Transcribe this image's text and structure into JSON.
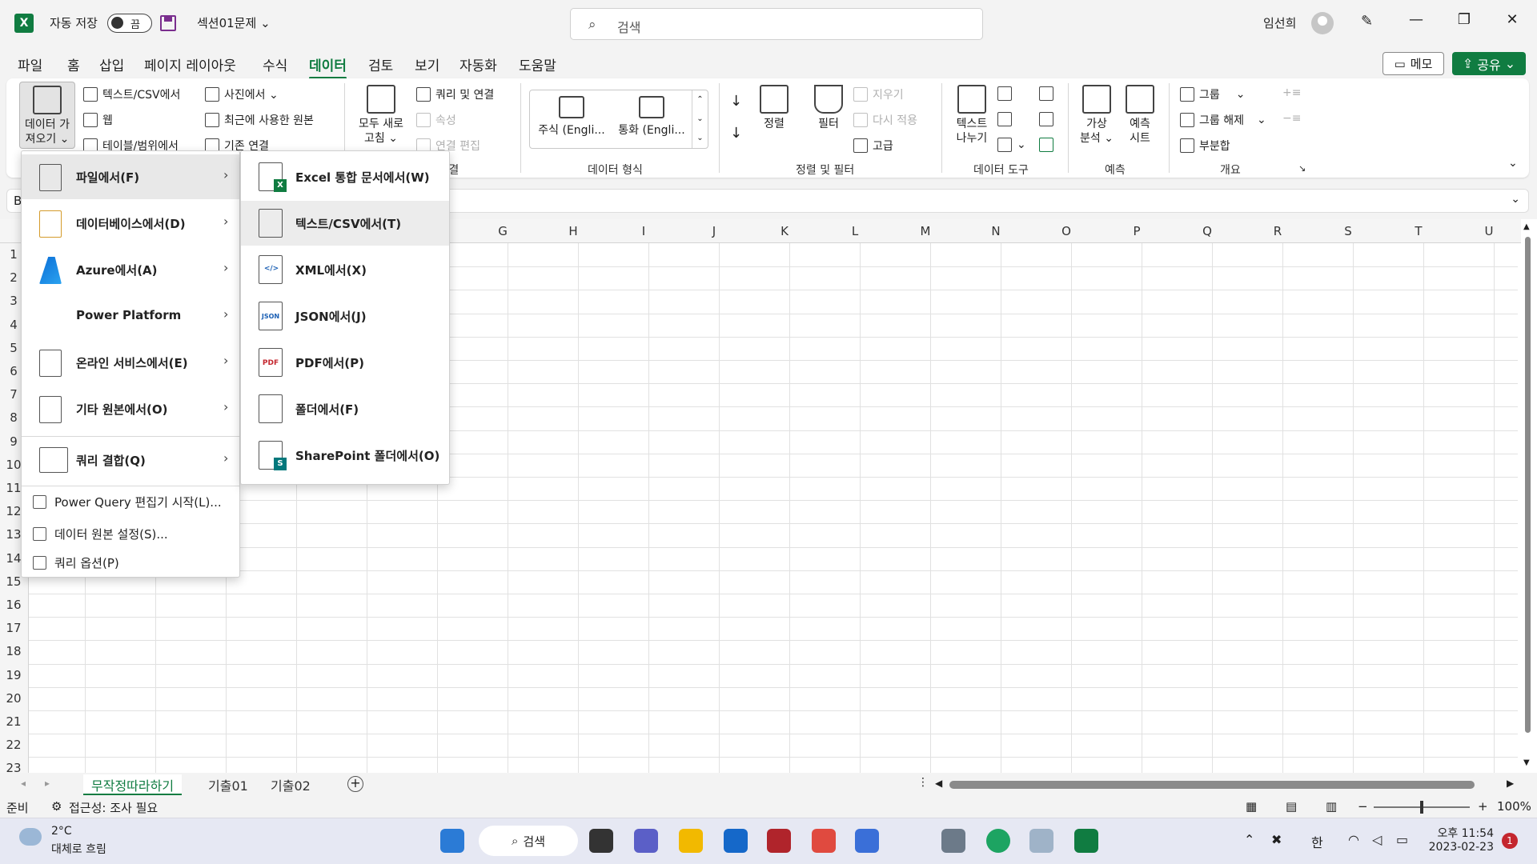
{
  "titlebar": {
    "app_icon": "X",
    "autosave_label": "자동 저장",
    "autosave_state": "끔",
    "document_title": "섹션01문제",
    "search_placeholder": "검색",
    "user_name": "임선희",
    "minimize": "—",
    "restore": "❐",
    "close": "✕"
  },
  "menu_tabs": [
    "파일",
    "홈",
    "삽입",
    "페이지 레이아웃",
    "수식",
    "데이터",
    "검토",
    "보기",
    "자동화",
    "도움말"
  ],
  "active_tab": "데이터",
  "memo_label": "메모",
  "share_label": "공유",
  "ribbon": {
    "get_data": "데이터 가\n져오기 ⌄",
    "text_csv": "텍스트/CSV에서",
    "web": "웹",
    "table_range": "테이블/범위에서",
    "from_picture": "사진에서 ⌄",
    "recent_sources": "최근에 사용한 원본",
    "existing_connections": "기존 연결",
    "refresh_all": "모두 새로\n고침 ⌄",
    "queries_connections": "쿼리 및 연결",
    "properties": "속성",
    "edit_links": "연결 편집",
    "group_queries": "쿼리 및 연결",
    "stocks": "주식 (Engli...",
    "currency": "통화 (Engli...",
    "group_datatypes": "데이터 형식",
    "sort": "정렬",
    "filter": "필터",
    "clear": "지우기",
    "reapply": "다시 적용",
    "advanced": "고급",
    "group_sortfilter": "정렬 및 필터",
    "text_to_columns": "텍스트\n나누기",
    "group_datatools": "데이터 도구",
    "whatif": "가상\n분석 ⌄",
    "forecast_sheet": "예측\n시트",
    "group_forecast": "예측",
    "group": "그룹",
    "ungroup": "그룹 해제",
    "subtotal": "부분합",
    "group_outline": "개요"
  },
  "columns": [
    "G",
    "H",
    "I",
    "J",
    "K",
    "L",
    "M",
    "N",
    "O",
    "P",
    "Q",
    "R",
    "S",
    "T",
    "U"
  ],
  "rows": [
    "1",
    "2",
    "3",
    "4",
    "5",
    "6",
    "7",
    "8",
    "9",
    "10",
    "11",
    "12",
    "13",
    "14",
    "15",
    "16",
    "17",
    "18",
    "19",
    "20",
    "21",
    "22",
    "23"
  ],
  "name_box_partial": "B",
  "menu1": {
    "items": [
      {
        "label": "파일에서(F)",
        "icon": "file-icon"
      },
      {
        "label": "데이터베이스에서(D)",
        "icon": "database-icon"
      },
      {
        "label": "Azure에서(A)",
        "icon": "azure-icon"
      },
      {
        "label": "Power Platform",
        "icon": "power-platform-icon"
      },
      {
        "label": "온라인 서비스에서(E)",
        "icon": "cloud-file-icon"
      },
      {
        "label": "기타 원본에서(O)",
        "icon": "other-source-icon"
      },
      {
        "label": "쿼리 결합(Q)",
        "icon": "combine-query-icon"
      }
    ],
    "small_items": [
      {
        "label": "Power Query 편집기 시작(L)...",
        "icon": "power-query-editor-icon"
      },
      {
        "label": "데이터 원본 설정(S)...",
        "icon": "data-source-settings-icon"
      },
      {
        "label": "쿼리 옵션(P)",
        "icon": "query-options-icon"
      }
    ]
  },
  "menu2": {
    "items": [
      {
        "label": "Excel 통합 문서에서(W)",
        "icon": "excel-workbook-icon"
      },
      {
        "label": "텍스트/CSV에서(T)",
        "icon": "text-csv-icon"
      },
      {
        "label": "XML에서(X)",
        "icon": "xml-icon"
      },
      {
        "label": "JSON에서(J)",
        "icon": "json-icon"
      },
      {
        "label": "PDF에서(P)",
        "icon": "pdf-icon"
      },
      {
        "label": "폴더에서(F)",
        "icon": "folder-icon"
      },
      {
        "label": "SharePoint 폴더에서(O)",
        "icon": "sharepoint-folder-icon"
      }
    ],
    "badges": {
      "excel": "X",
      "json": "JSON",
      "pdf": "PDF",
      "xml": "</>",
      "sharepoint": "S"
    }
  },
  "sheets": [
    "무작정따라하기",
    "기출01",
    "기출02"
  ],
  "active_sheet": "무작정따라하기",
  "status": {
    "ready": "준비",
    "accessibility": "접근성: 조사 필요",
    "zoom_minus": "−",
    "zoom_plus": "+",
    "zoom": "100%"
  },
  "taskbar": {
    "temperature": "2°C",
    "weather": "대체로 흐림",
    "search": "검색",
    "ime": "한",
    "time": "오후 11:54",
    "date": "2023-02-23",
    "notifications": "1"
  },
  "colors": {
    "excel_green": "#107c41",
    "accent_purple": "#7a2e8e"
  }
}
